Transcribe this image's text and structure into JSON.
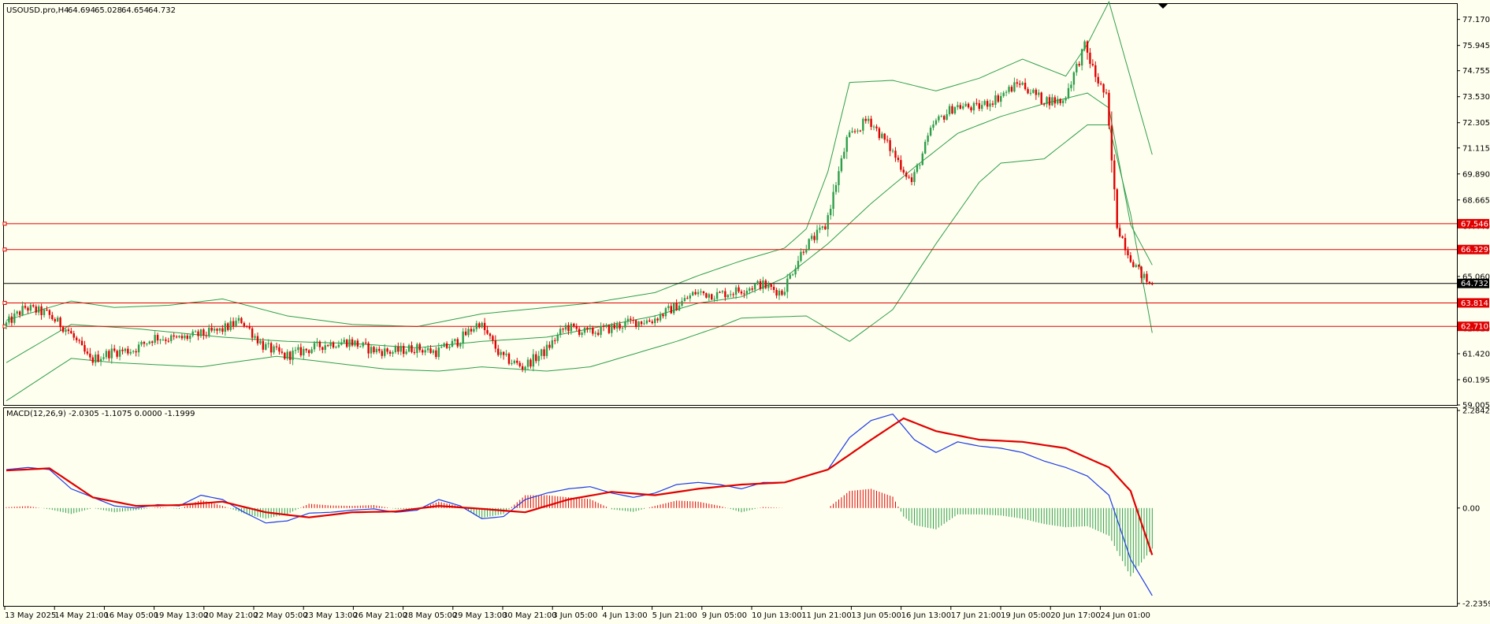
{
  "chart_data": [
    {
      "type": "candlestick",
      "title": "USOUSD.pro,H4",
      "ohlc_header": {
        "open": "64.694",
        "high": "65.028",
        "low": "64.654",
        "close": "64.732"
      },
      "ylim": [
        59.005,
        77.9
      ],
      "y_ticks": [
        "77.170",
        "75.945",
        "74.755",
        "73.530",
        "72.305",
        "71.115",
        "69.890",
        "68.665",
        "67.440",
        "66.250",
        "65.060",
        "63.835",
        "62.610",
        "61.420",
        "60.195",
        "59.005"
      ],
      "current_price": "64.732",
      "horizontal_levels": [
        "67.546",
        "66.329",
        "63.814",
        "62.710"
      ],
      "x_ticks": [
        "13 May 2025",
        "14 May 21:00",
        "16 May 05:00",
        "19 May 13:00",
        "20 May 21:00",
        "22 May 05:00",
        "23 May 13:00",
        "26 May 21:00",
        "28 May 05:00",
        "29 May 13:00",
        "30 May 21:00",
        "3 Jun 05:00",
        "4 Jun 13:00",
        "5 Jun 21:00",
        "9 Jun 05:00",
        "10 Jun 13:00",
        "11 Jun 21:00",
        "13 Jun 05:00",
        "16 Jun 13:00",
        "17 Jun 21:00",
        "19 Jun 05:00",
        "20 Jun 17:00",
        "24 Jun 01:00"
      ],
      "keypoints": [
        [
          0,
          62.7
        ],
        [
          8,
          63.6
        ],
        [
          16,
          63.3
        ],
        [
          24,
          62.5
        ],
        [
          32,
          61.1
        ],
        [
          40,
          61.5
        ],
        [
          48,
          61.6
        ],
        [
          56,
          62.2
        ],
        [
          64,
          62.1
        ],
        [
          72,
          62.3
        ],
        [
          80,
          62.5
        ],
        [
          88,
          63.0
        ],
        [
          96,
          61.8
        ],
        [
          104,
          61.3
        ],
        [
          112,
          61.6
        ],
        [
          120,
          61.9
        ],
        [
          128,
          62.0
        ],
        [
          136,
          61.6
        ],
        [
          144,
          61.5
        ],
        [
          152,
          61.7
        ],
        [
          160,
          61.5
        ],
        [
          168,
          62.0
        ],
        [
          176,
          62.9
        ],
        [
          184,
          61.3
        ],
        [
          192,
          60.8
        ],
        [
          200,
          61.5
        ],
        [
          208,
          62.7
        ],
        [
          216,
          62.4
        ],
        [
          224,
          62.6
        ],
        [
          232,
          62.9
        ],
        [
          240,
          63.0
        ],
        [
          248,
          63.6
        ],
        [
          256,
          64.3
        ],
        [
          264,
          64.2
        ],
        [
          272,
          64.4
        ],
        [
          280,
          64.7
        ],
        [
          288,
          64.3
        ],
        [
          296,
          66.4
        ],
        [
          304,
          67.4
        ],
        [
          312,
          71.5
        ],
        [
          320,
          72.5
        ],
        [
          328,
          71.1
        ],
        [
          336,
          69.5
        ],
        [
          344,
          72.2
        ],
        [
          352,
          73.1
        ],
        [
          360,
          73.0
        ],
        [
          368,
          73.5
        ],
        [
          376,
          74.2
        ],
        [
          384,
          73.4
        ],
        [
          392,
          73.3
        ],
        [
          400,
          75.9
        ],
        [
          404,
          74.5
        ],
        [
          408,
          73.5
        ],
        [
          412,
          67.5
        ],
        [
          416,
          66.2
        ],
        [
          420,
          65.3
        ],
        [
          424,
          64.7
        ]
      ],
      "bollinger": {
        "upper": [
          [
            0,
            63.0
          ],
          [
            24,
            63.9
          ],
          [
            40,
            63.6
          ],
          [
            60,
            63.7
          ],
          [
            80,
            64.0
          ],
          [
            104,
            63.2
          ],
          [
            128,
            62.8
          ],
          [
            152,
            62.7
          ],
          [
            176,
            63.3
          ],
          [
            200,
            63.6
          ],
          [
            216,
            63.8
          ],
          [
            240,
            64.3
          ],
          [
            256,
            65.1
          ],
          [
            272,
            65.8
          ],
          [
            288,
            66.4
          ],
          [
            296,
            67.3
          ],
          [
            304,
            70.0
          ],
          [
            312,
            74.2
          ],
          [
            328,
            74.3
          ],
          [
            344,
            73.8
          ],
          [
            360,
            74.4
          ],
          [
            376,
            75.3
          ],
          [
            392,
            74.5
          ],
          [
            400,
            76.0
          ],
          [
            408,
            78.0
          ],
          [
            424,
            70.8
          ]
        ],
        "middle": [
          [
            0,
            61.0
          ],
          [
            24,
            62.8
          ],
          [
            48,
            62.6
          ],
          [
            80,
            62.2
          ],
          [
            104,
            62.0
          ],
          [
            128,
            61.9
          ],
          [
            152,
            61.7
          ],
          [
            176,
            62.0
          ],
          [
            200,
            62.2
          ],
          [
            216,
            62.6
          ],
          [
            240,
            63.2
          ],
          [
            256,
            63.8
          ],
          [
            272,
            64.1
          ],
          [
            288,
            65.0
          ],
          [
            304,
            66.6
          ],
          [
            320,
            68.5
          ],
          [
            336,
            70.2
          ],
          [
            352,
            71.8
          ],
          [
            368,
            72.6
          ],
          [
            384,
            73.2
          ],
          [
            400,
            73.7
          ],
          [
            408,
            73.0
          ],
          [
            416,
            67.5
          ],
          [
            424,
            65.6
          ]
        ],
        "lower": [
          [
            0,
            59.2
          ],
          [
            24,
            61.2
          ],
          [
            40,
            61.0
          ],
          [
            72,
            60.8
          ],
          [
            100,
            61.3
          ],
          [
            120,
            61.0
          ],
          [
            140,
            60.7
          ],
          [
            160,
            60.6
          ],
          [
            176,
            60.8
          ],
          [
            200,
            60.6
          ],
          [
            216,
            60.8
          ],
          [
            232,
            61.4
          ],
          [
            248,
            62.0
          ],
          [
            264,
            62.7
          ],
          [
            272,
            63.1
          ],
          [
            296,
            63.2
          ],
          [
            312,
            62.0
          ],
          [
            328,
            63.5
          ],
          [
            344,
            66.6
          ],
          [
            360,
            69.5
          ],
          [
            368,
            70.4
          ],
          [
            384,
            70.6
          ],
          [
            400,
            72.2
          ],
          [
            408,
            72.2
          ],
          [
            416,
            68.0
          ],
          [
            424,
            62.4
          ]
        ]
      }
    },
    {
      "type": "macd",
      "title": "MACD(12,26,9) -2.0305 -1.1075 0.0000 -1.1999",
      "ylim": [
        -2.2359,
        2.2842
      ],
      "y_ticks": [
        "2.2842",
        "0.00",
        "-2.2359"
      ],
      "macd": [
        [
          0,
          0.9
        ],
        [
          8,
          0.95
        ],
        [
          16,
          0.9
        ],
        [
          24,
          0.45
        ],
        [
          32,
          0.25
        ],
        [
          40,
          0.05
        ],
        [
          48,
          0.0
        ],
        [
          56,
          0.08
        ],
        [
          64,
          0.05
        ],
        [
          72,
          0.3
        ],
        [
          80,
          0.2
        ],
        [
          88,
          -0.1
        ],
        [
          96,
          -0.35
        ],
        [
          104,
          -0.3
        ],
        [
          112,
          -0.12
        ],
        [
          120,
          -0.1
        ],
        [
          128,
          -0.05
        ],
        [
          136,
          -0.02
        ],
        [
          144,
          -0.1
        ],
        [
          152,
          -0.05
        ],
        [
          160,
          0.2
        ],
        [
          168,
          0.05
        ],
        [
          176,
          -0.25
        ],
        [
          184,
          -0.2
        ],
        [
          192,
          0.2
        ],
        [
          200,
          0.35
        ],
        [
          208,
          0.45
        ],
        [
          216,
          0.5
        ],
        [
          224,
          0.35
        ],
        [
          232,
          0.25
        ],
        [
          240,
          0.35
        ],
        [
          248,
          0.55
        ],
        [
          256,
          0.6
        ],
        [
          264,
          0.55
        ],
        [
          272,
          0.45
        ],
        [
          280,
          0.6
        ],
        [
          288,
          0.6
        ],
        [
          296,
          0.75
        ],
        [
          304,
          0.9
        ],
        [
          312,
          1.65
        ],
        [
          320,
          2.05
        ],
        [
          328,
          2.2
        ],
        [
          336,
          1.6
        ],
        [
          344,
          1.3
        ],
        [
          352,
          1.55
        ],
        [
          360,
          1.45
        ],
        [
          368,
          1.4
        ],
        [
          376,
          1.3
        ],
        [
          384,
          1.1
        ],
        [
          392,
          0.95
        ],
        [
          400,
          0.75
        ],
        [
          408,
          0.3
        ],
        [
          416,
          -1.2
        ],
        [
          424,
          -2.05
        ]
      ],
      "signal": [
        [
          0,
          0.88
        ],
        [
          16,
          0.93
        ],
        [
          32,
          0.25
        ],
        [
          48,
          0.05
        ],
        [
          64,
          0.07
        ],
        [
          80,
          0.15
        ],
        [
          96,
          -0.1
        ],
        [
          112,
          -0.22
        ],
        [
          128,
          -0.1
        ],
        [
          144,
          -0.08
        ],
        [
          160,
          0.05
        ],
        [
          176,
          -0.02
        ],
        [
          192,
          -0.1
        ],
        [
          208,
          0.2
        ],
        [
          224,
          0.38
        ],
        [
          240,
          0.3
        ],
        [
          256,
          0.45
        ],
        [
          272,
          0.55
        ],
        [
          288,
          0.6
        ],
        [
          304,
          0.9
        ],
        [
          320,
          1.6
        ],
        [
          332,
          2.1
        ],
        [
          344,
          1.8
        ],
        [
          360,
          1.6
        ],
        [
          376,
          1.55
        ],
        [
          392,
          1.4
        ],
        [
          408,
          0.95
        ],
        [
          416,
          0.4
        ],
        [
          424,
          -1.1
        ]
      ]
    }
  ]
}
